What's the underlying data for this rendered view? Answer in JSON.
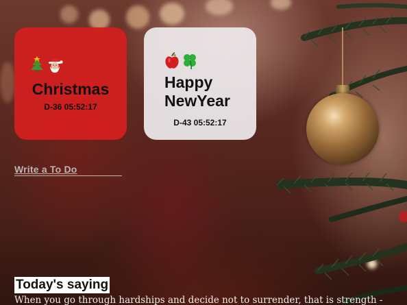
{
  "cards": {
    "christmas": {
      "title": "Christmas",
      "countdown": "D-36 05:52:17",
      "icons": [
        "christmas-tree-icon",
        "santa-claus-icon"
      ],
      "color": "#d11f1f"
    },
    "newyear": {
      "title_line1": "Happy",
      "title_line2": "NewYear",
      "countdown": "D-43 05:52:17",
      "icons": [
        "apple-icon",
        "four-leaf-clover-icon"
      ],
      "color": "#ece8ea"
    }
  },
  "todo": {
    "link_label": "Write a To Do"
  },
  "saying": {
    "heading": "Today's saying",
    "text": "When you go through hardships and decide not to surrender, that is strength -"
  }
}
